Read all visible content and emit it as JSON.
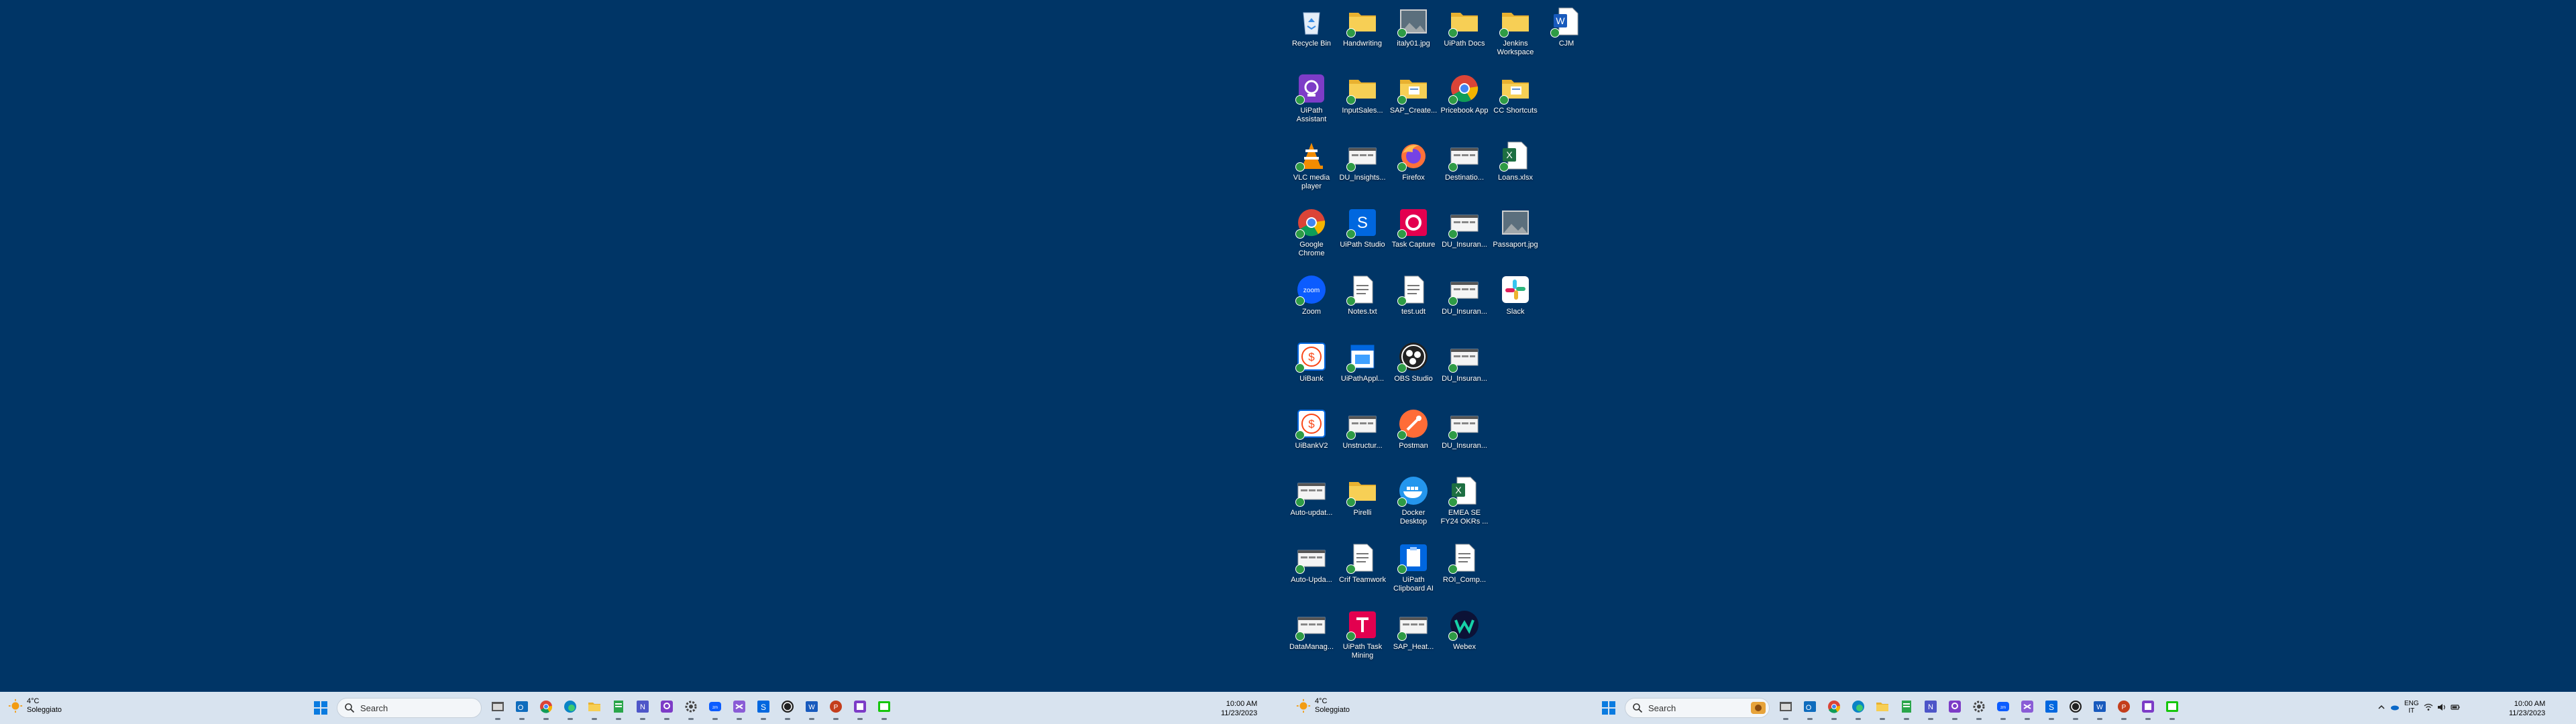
{
  "desktop": {
    "columns": [
      [
        {
          "label": "Recycle Bin",
          "icon": "recycle-bin-icon",
          "sync": false
        },
        {
          "label": "UiPath Assistant",
          "icon": "uipath-assistant-icon",
          "sync": true
        },
        {
          "label": "VLC media player",
          "icon": "vlc-icon",
          "sync": true
        },
        {
          "label": "Google Chrome",
          "icon": "chrome-icon",
          "sync": true
        },
        {
          "label": "Zoom",
          "icon": "zoom-icon",
          "sync": true
        },
        {
          "label": "UiBank",
          "icon": "uibank-icon",
          "sync": true
        },
        {
          "label": "UiBankV2",
          "icon": "uibank-icon",
          "sync": true
        },
        {
          "label": "Auto-updat...",
          "icon": "shortcut-window-icon",
          "sync": true
        },
        {
          "label": "Auto-Upda...",
          "icon": "shortcut-window-icon",
          "sync": true
        },
        {
          "label": "DataManag...",
          "icon": "shortcut-window-icon",
          "sync": true
        }
      ],
      [
        {
          "label": "Handwriting",
          "icon": "folder-icon",
          "sync": true
        },
        {
          "label": "InputSales...",
          "icon": "folder-icon",
          "sync": true
        },
        {
          "label": "DU_Insights...",
          "icon": "shortcut-window-icon",
          "sync": true
        },
        {
          "label": "UiPath Studio",
          "icon": "uipath-studio-icon",
          "sync": true
        },
        {
          "label": "Notes.txt",
          "icon": "text-file-icon",
          "sync": true
        },
        {
          "label": "UiPathAppl...",
          "icon": "uipath-app-icon",
          "sync": true
        },
        {
          "label": "Unstructur...",
          "icon": "shortcut-window-icon",
          "sync": true
        },
        {
          "label": "Pirelli",
          "icon": "folder-icon",
          "sync": true
        },
        {
          "label": "Crif Teamwork",
          "icon": "text-file-icon",
          "sync": true
        },
        {
          "label": "UiPath Task Mining",
          "icon": "task-mining-icon",
          "sync": true
        }
      ],
      [
        {
          "label": "italy01.jpg",
          "icon": "image-file-icon",
          "sync": true
        },
        {
          "label": "SAP_Create...",
          "icon": "folder-shortcut-icon",
          "sync": true
        },
        {
          "label": "Firefox",
          "icon": "firefox-icon",
          "sync": true
        },
        {
          "label": "Task Capture",
          "icon": "task-capture-icon",
          "sync": true
        },
        {
          "label": "test.udt",
          "icon": "text-file-icon",
          "sync": true
        },
        {
          "label": "OBS Studio",
          "icon": "obs-icon",
          "sync": true
        },
        {
          "label": "Postman",
          "icon": "postman-icon",
          "sync": true
        },
        {
          "label": "Docker Desktop",
          "icon": "docker-icon",
          "sync": true
        },
        {
          "label": "UiPath Clipboard AI",
          "icon": "clipboard-ai-icon",
          "sync": true
        },
        {
          "label": "SAP_Heat...",
          "icon": "shortcut-window-icon",
          "sync": true
        }
      ],
      [
        {
          "label": "UiPath Docs",
          "icon": "folder-icon",
          "sync": true
        },
        {
          "label": "Pricebook App",
          "icon": "chrome-icon",
          "sync": true
        },
        {
          "label": "Destinatio...",
          "icon": "shortcut-window-icon",
          "sync": true
        },
        {
          "label": "DU_Insuran...",
          "icon": "shortcut-window-icon",
          "sync": true
        },
        {
          "label": "DU_Insuran...",
          "icon": "shortcut-window-icon",
          "sync": true
        },
        {
          "label": "DU_Insuran...",
          "icon": "shortcut-window-icon",
          "sync": true
        },
        {
          "label": "DU_Insuran...",
          "icon": "shortcut-window-icon",
          "sync": true
        },
        {
          "label": "EMEA SE FY24 OKRs ...",
          "icon": "excel-file-icon",
          "sync": true
        },
        {
          "label": "ROI_Comp...",
          "icon": "text-file-icon",
          "sync": true
        },
        {
          "label": "Webex",
          "icon": "webex-icon",
          "sync": true
        }
      ],
      [
        {
          "label": "Jenkins Workspace",
          "icon": "folder-icon",
          "sync": true
        },
        {
          "label": "CC Shortcuts",
          "icon": "folder-shortcut-icon",
          "sync": true
        },
        {
          "label": "Loans.xlsx",
          "icon": "excel-file-icon",
          "sync": true
        },
        {
          "label": "Passaport.jpg",
          "icon": "image-file-icon",
          "sync": false
        },
        {
          "label": "Slack",
          "icon": "slack-icon",
          "sync": false
        }
      ],
      [
        {
          "label": "CJM",
          "icon": "word-file-icon",
          "sync": true
        }
      ]
    ]
  },
  "taskbar_left": {
    "weather_temp": "4°C",
    "weather_desc": "Soleggiato",
    "search_placeholder": "Search",
    "time": "10:00 AM",
    "date": "11/23/2023",
    "apps": [
      "file-explorer-icon",
      "outlook-icon",
      "chrome-icon",
      "edge-icon",
      "folder-icon",
      "notepad-icon",
      "onenote-icon",
      "uipath-assistant-icon",
      "settings-icon",
      "zoom-icon",
      "visual-studio-icon",
      "uipath-studio-icon",
      "obs-icon",
      "word-icon",
      "powerpoint-icon",
      "uipath-app-icon",
      "terminal-icon"
    ]
  },
  "taskbar_right": {
    "weather_temp": "4°C",
    "weather_desc": "Soleggiato",
    "search_placeholder": "Search",
    "lang_top": "ENG",
    "lang_bottom": "IT",
    "time": "10:00 AM",
    "date": "11/23/2023",
    "apps": [
      "file-explorer-icon",
      "outlook-icon",
      "chrome-icon",
      "edge-icon",
      "folder-icon",
      "notepad-icon",
      "onenote-icon",
      "uipath-assistant-icon",
      "settings-icon",
      "zoom-icon",
      "visual-studio-icon",
      "uipath-studio-icon",
      "obs-icon",
      "word-icon",
      "powerpoint-icon",
      "uipath-app-icon",
      "terminal-icon"
    ]
  },
  "colors": {
    "desktop_bg": "#003566",
    "taskbar_bg": "#d8e3ef",
    "folder": "#f5c542",
    "uipath_orange": "#fa4616",
    "uipath_blue": "#0067df"
  }
}
